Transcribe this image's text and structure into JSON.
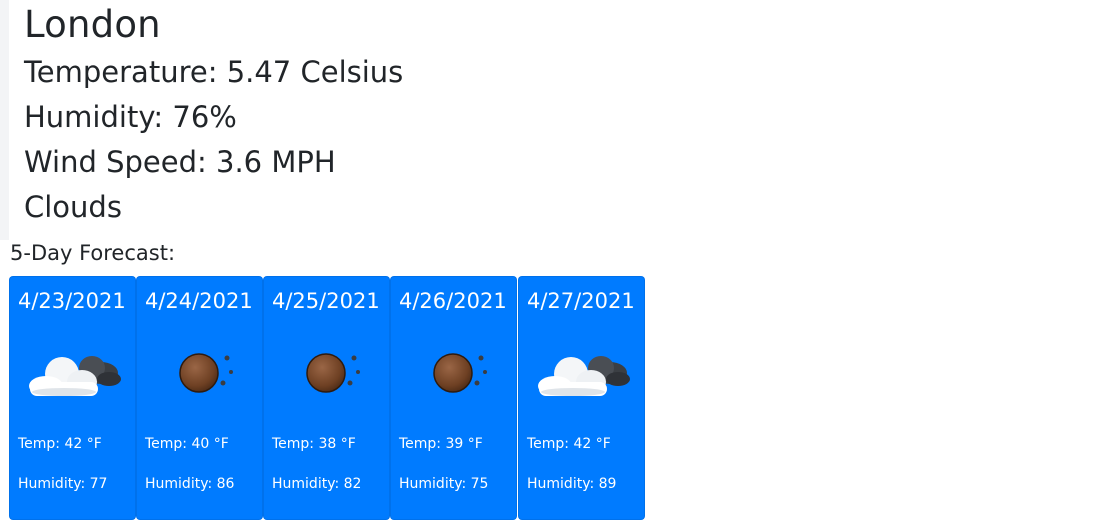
{
  "current": {
    "city": "London",
    "temperature": "Temperature: 5.47 Celsius",
    "humidity": "Humidity: 76%",
    "wind": "Wind Speed: 3.6 MPH",
    "description": "Clouds"
  },
  "forecast": {
    "label": "5-Day Forecast:",
    "card_color": "#007bff",
    "days": [
      {
        "date": "4/23/2021",
        "icon": "clouds-icon",
        "temp": "Temp: 42 °F",
        "humidity": "Humidity: 77"
      },
      {
        "date": "4/24/2021",
        "icon": "clear-night-icon",
        "temp": "Temp: 40 °F",
        "humidity": "Humidity: 86"
      },
      {
        "date": "4/25/2021",
        "icon": "clear-night-icon",
        "temp": "Temp: 38 °F",
        "humidity": "Humidity: 82"
      },
      {
        "date": "4/26/2021",
        "icon": "clear-night-icon",
        "temp": "Temp: 39 °F",
        "humidity": "Humidity: 75"
      },
      {
        "date": "4/27/2021",
        "icon": "clouds-icon",
        "temp": "Temp: 42 °F",
        "humidity": "Humidity: 89"
      }
    ]
  }
}
